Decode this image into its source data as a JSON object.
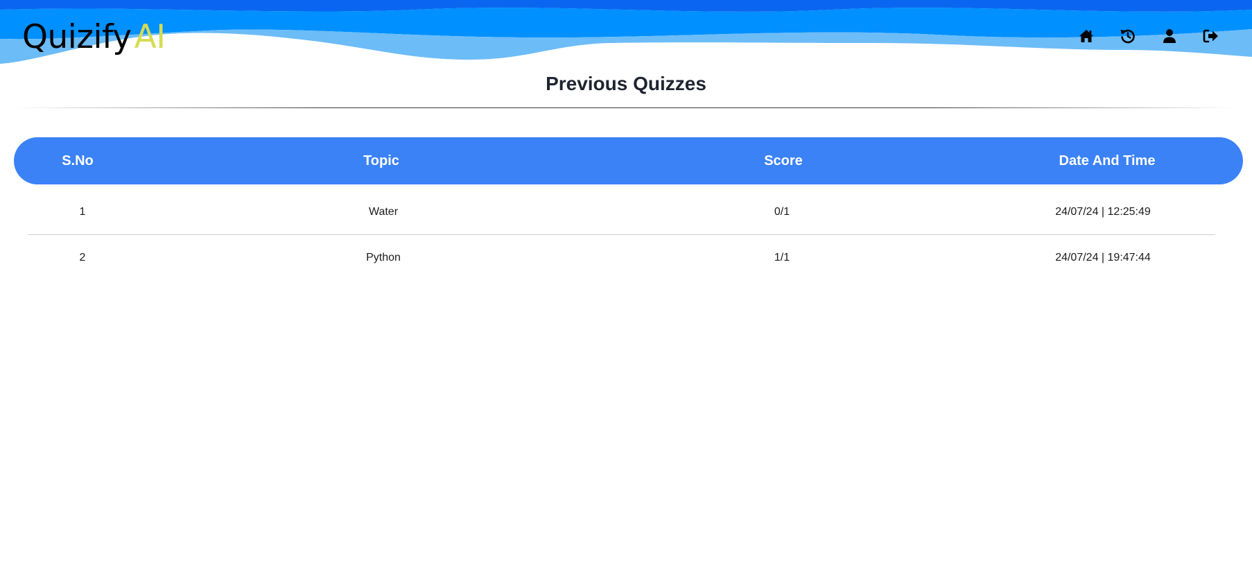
{
  "header": {
    "logo_main": "Quizify",
    "logo_accent": "AI",
    "colors": {
      "wave_dark": "#0a66f0",
      "wave_mid": "#0090ff",
      "wave_light": "#6cbcf7",
      "logo_accent": "#d6dc52"
    },
    "nav": [
      {
        "icon": "home-icon"
      },
      {
        "icon": "history-icon"
      },
      {
        "icon": "user-icon"
      },
      {
        "icon": "logout-icon"
      }
    ]
  },
  "main": {
    "title": "Previous Quizzes",
    "table": {
      "header_color": "#3b82f6",
      "columns": [
        "S.No",
        "Topic",
        "Score",
        "Date And Time"
      ],
      "rows": [
        {
          "sno": "1",
          "topic": "Water",
          "score": "0/1",
          "datetime": "24/07/24 | 12:25:49"
        },
        {
          "sno": "2",
          "topic": "Python",
          "score": "1/1",
          "datetime": "24/07/24 | 19:47:44"
        }
      ]
    }
  }
}
